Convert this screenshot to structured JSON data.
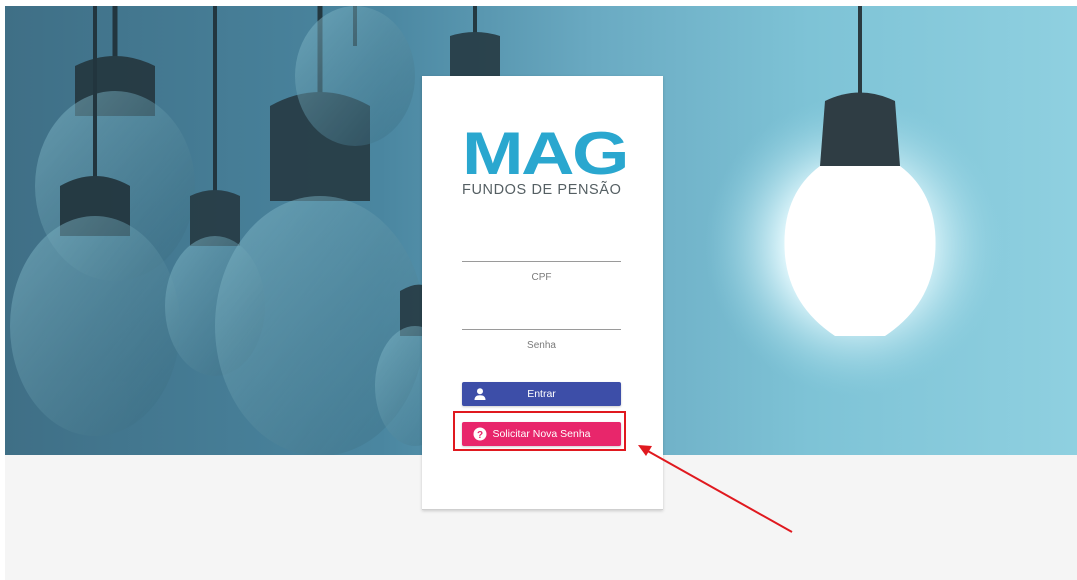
{
  "brand": {
    "logo_text": "MAG",
    "subtitle": "FUNDOS DE PENSÃO",
    "accent_color": "#2aa7cf"
  },
  "form": {
    "cpf_label": "CPF",
    "senha_label": "Senha",
    "entrar_label": "Entrar",
    "solicitar_label": "Solicitar Nova Senha"
  },
  "colors": {
    "entrar_button": "#3d4ea8",
    "solicitar_button": "#e8266b",
    "annotation_red": "#e0191f"
  },
  "icons": {
    "entrar": "user-icon",
    "solicitar": "question-circle-icon"
  }
}
